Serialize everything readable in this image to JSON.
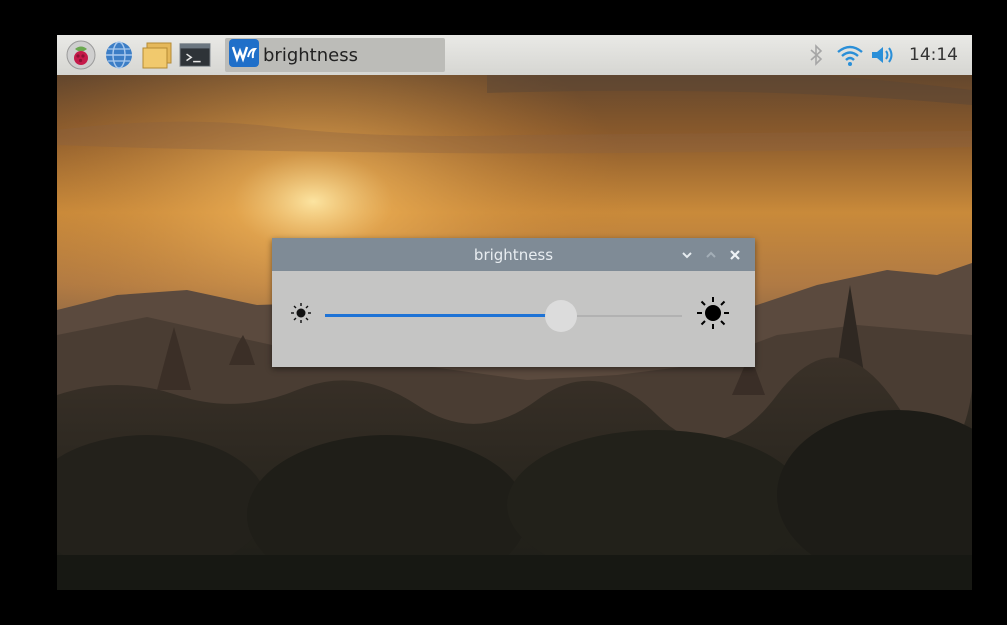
{
  "taskbar": {
    "launchers": [
      {
        "icon": "raspberry-menu-icon"
      },
      {
        "icon": "web-browser-icon"
      },
      {
        "icon": "file-manager-icon"
      },
      {
        "icon": "terminal-icon"
      }
    ],
    "task": {
      "icon": "waveshare-app-icon",
      "label": "brightness"
    },
    "tray": {
      "icons": [
        "bluetooth-icon",
        "wifi-icon",
        "volume-icon"
      ],
      "clock": "14:14"
    }
  },
  "dialog": {
    "title": "brightness",
    "controls": [
      "minimize-icon",
      "maximize-icon",
      "close-icon"
    ],
    "slider": {
      "value_fraction": 0.66,
      "min_icon": "brightness-low-icon",
      "max_icon": "brightness-high-icon"
    }
  },
  "colors": {
    "accent": "#1e73d6",
    "titlebar": "#7f8b96",
    "dialog_bg": "#c5c5c4",
    "taskbar": "#dedede"
  }
}
